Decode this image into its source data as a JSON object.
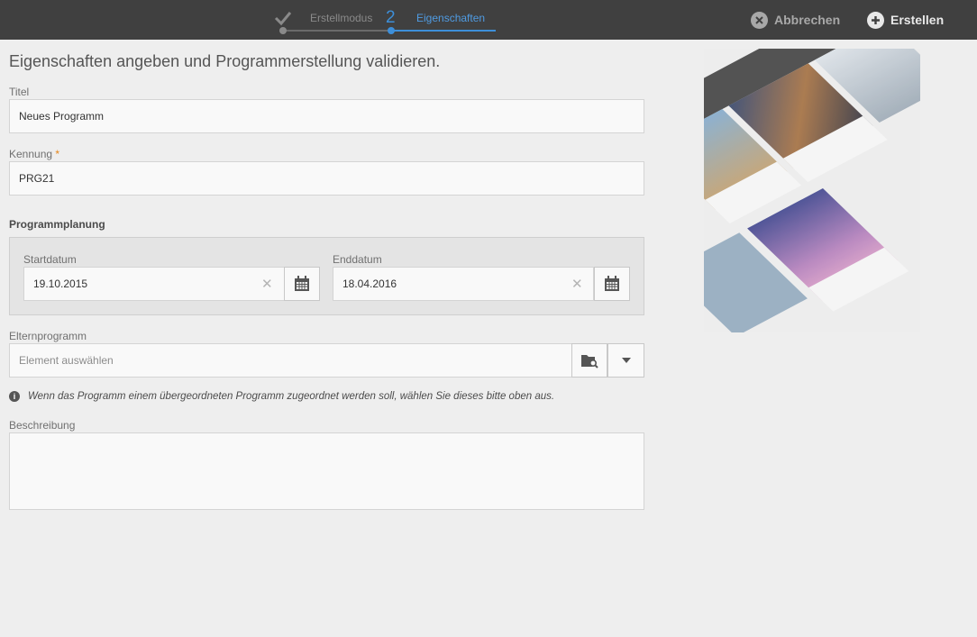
{
  "wizard": {
    "step1_label": "Erstellmodus",
    "step2_number": "2",
    "step2_label": "Eigenschaften",
    "active_step": 2
  },
  "actions": {
    "cancel_label": "Abbrechen",
    "create_label": "Erstellen"
  },
  "form": {
    "heading": "Eigenschaften angeben und Programmerstellung validieren.",
    "title_label": "Titel",
    "title_value": "Neues Programm",
    "id_label": "Kennung",
    "id_required": "*",
    "id_value": "PRG21",
    "schedule_heading": "Programmplanung",
    "start_label": "Startdatum",
    "start_value": "19.10.2015",
    "end_label": "Enddatum",
    "end_value": "18.04.2016",
    "parent_label": "Elternprogramm",
    "parent_placeholder": "Element auswählen",
    "info_text": "Wenn das Programm einem übergeordneten Programm zugeordnet werden soll, wählen Sie dieses bitte oben aus.",
    "description_label": "Beschreibung",
    "description_value": ""
  },
  "icons": {
    "cancel": "close-circle-icon",
    "create": "plus-circle-icon",
    "calendar": "calendar-icon",
    "clear": "clear-icon",
    "browse": "folder-search-icon",
    "dropdown": "chevron-down-icon",
    "info": "info-icon"
  },
  "colors": {
    "topbar": "#404040",
    "accent": "#3d8fd9",
    "required": "#e68619",
    "background": "#eeeeee"
  }
}
